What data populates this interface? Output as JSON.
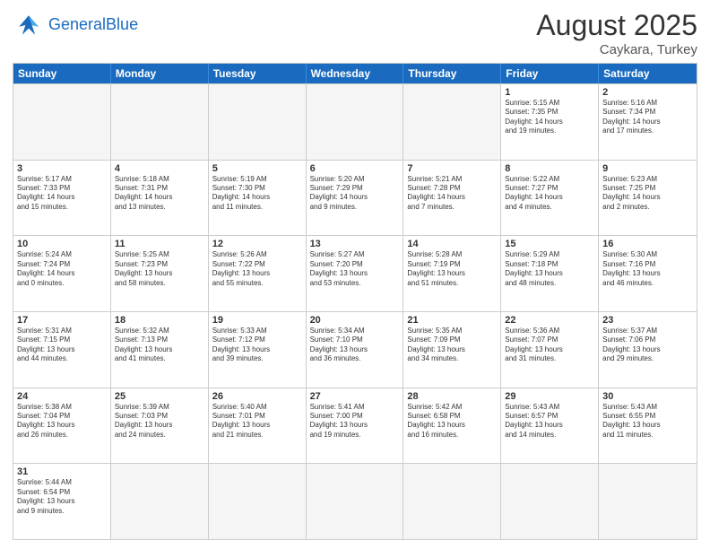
{
  "header": {
    "logo_general": "General",
    "logo_blue": "Blue",
    "title": "August 2025",
    "subtitle": "Caykara, Turkey"
  },
  "days_of_week": [
    "Sunday",
    "Monday",
    "Tuesday",
    "Wednesday",
    "Thursday",
    "Friday",
    "Saturday"
  ],
  "weeks": [
    [
      {
        "day": "",
        "info": "",
        "empty": true
      },
      {
        "day": "",
        "info": "",
        "empty": true
      },
      {
        "day": "",
        "info": "",
        "empty": true
      },
      {
        "day": "",
        "info": "",
        "empty": true
      },
      {
        "day": "",
        "info": "",
        "empty": true
      },
      {
        "day": "1",
        "info": "Sunrise: 5:15 AM\nSunset: 7:35 PM\nDaylight: 14 hours\nand 19 minutes."
      },
      {
        "day": "2",
        "info": "Sunrise: 5:16 AM\nSunset: 7:34 PM\nDaylight: 14 hours\nand 17 minutes."
      }
    ],
    [
      {
        "day": "3",
        "info": "Sunrise: 5:17 AM\nSunset: 7:33 PM\nDaylight: 14 hours\nand 15 minutes."
      },
      {
        "day": "4",
        "info": "Sunrise: 5:18 AM\nSunset: 7:31 PM\nDaylight: 14 hours\nand 13 minutes."
      },
      {
        "day": "5",
        "info": "Sunrise: 5:19 AM\nSunset: 7:30 PM\nDaylight: 14 hours\nand 11 minutes."
      },
      {
        "day": "6",
        "info": "Sunrise: 5:20 AM\nSunset: 7:29 PM\nDaylight: 14 hours\nand 9 minutes."
      },
      {
        "day": "7",
        "info": "Sunrise: 5:21 AM\nSunset: 7:28 PM\nDaylight: 14 hours\nand 7 minutes."
      },
      {
        "day": "8",
        "info": "Sunrise: 5:22 AM\nSunset: 7:27 PM\nDaylight: 14 hours\nand 4 minutes."
      },
      {
        "day": "9",
        "info": "Sunrise: 5:23 AM\nSunset: 7:25 PM\nDaylight: 14 hours\nand 2 minutes."
      }
    ],
    [
      {
        "day": "10",
        "info": "Sunrise: 5:24 AM\nSunset: 7:24 PM\nDaylight: 14 hours\nand 0 minutes."
      },
      {
        "day": "11",
        "info": "Sunrise: 5:25 AM\nSunset: 7:23 PM\nDaylight: 13 hours\nand 58 minutes."
      },
      {
        "day": "12",
        "info": "Sunrise: 5:26 AM\nSunset: 7:22 PM\nDaylight: 13 hours\nand 55 minutes."
      },
      {
        "day": "13",
        "info": "Sunrise: 5:27 AM\nSunset: 7:20 PM\nDaylight: 13 hours\nand 53 minutes."
      },
      {
        "day": "14",
        "info": "Sunrise: 5:28 AM\nSunset: 7:19 PM\nDaylight: 13 hours\nand 51 minutes."
      },
      {
        "day": "15",
        "info": "Sunrise: 5:29 AM\nSunset: 7:18 PM\nDaylight: 13 hours\nand 48 minutes."
      },
      {
        "day": "16",
        "info": "Sunrise: 5:30 AM\nSunset: 7:16 PM\nDaylight: 13 hours\nand 46 minutes."
      }
    ],
    [
      {
        "day": "17",
        "info": "Sunrise: 5:31 AM\nSunset: 7:15 PM\nDaylight: 13 hours\nand 44 minutes."
      },
      {
        "day": "18",
        "info": "Sunrise: 5:32 AM\nSunset: 7:13 PM\nDaylight: 13 hours\nand 41 minutes."
      },
      {
        "day": "19",
        "info": "Sunrise: 5:33 AM\nSunset: 7:12 PM\nDaylight: 13 hours\nand 39 minutes."
      },
      {
        "day": "20",
        "info": "Sunrise: 5:34 AM\nSunset: 7:10 PM\nDaylight: 13 hours\nand 36 minutes."
      },
      {
        "day": "21",
        "info": "Sunrise: 5:35 AM\nSunset: 7:09 PM\nDaylight: 13 hours\nand 34 minutes."
      },
      {
        "day": "22",
        "info": "Sunrise: 5:36 AM\nSunset: 7:07 PM\nDaylight: 13 hours\nand 31 minutes."
      },
      {
        "day": "23",
        "info": "Sunrise: 5:37 AM\nSunset: 7:06 PM\nDaylight: 13 hours\nand 29 minutes."
      }
    ],
    [
      {
        "day": "24",
        "info": "Sunrise: 5:38 AM\nSunset: 7:04 PM\nDaylight: 13 hours\nand 26 minutes."
      },
      {
        "day": "25",
        "info": "Sunrise: 5:39 AM\nSunset: 7:03 PM\nDaylight: 13 hours\nand 24 minutes."
      },
      {
        "day": "26",
        "info": "Sunrise: 5:40 AM\nSunset: 7:01 PM\nDaylight: 13 hours\nand 21 minutes."
      },
      {
        "day": "27",
        "info": "Sunrise: 5:41 AM\nSunset: 7:00 PM\nDaylight: 13 hours\nand 19 minutes."
      },
      {
        "day": "28",
        "info": "Sunrise: 5:42 AM\nSunset: 6:58 PM\nDaylight: 13 hours\nand 16 minutes."
      },
      {
        "day": "29",
        "info": "Sunrise: 5:43 AM\nSunset: 6:57 PM\nDaylight: 13 hours\nand 14 minutes."
      },
      {
        "day": "30",
        "info": "Sunrise: 5:43 AM\nSunset: 6:55 PM\nDaylight: 13 hours\nand 11 minutes."
      }
    ],
    [
      {
        "day": "31",
        "info": "Sunrise: 5:44 AM\nSunset: 6:54 PM\nDaylight: 13 hours\nand 9 minutes."
      },
      {
        "day": "",
        "info": "",
        "empty": true
      },
      {
        "day": "",
        "info": "",
        "empty": true
      },
      {
        "day": "",
        "info": "",
        "empty": true
      },
      {
        "day": "",
        "info": "",
        "empty": true
      },
      {
        "day": "",
        "info": "",
        "empty": true
      },
      {
        "day": "",
        "info": "",
        "empty": true
      }
    ]
  ]
}
